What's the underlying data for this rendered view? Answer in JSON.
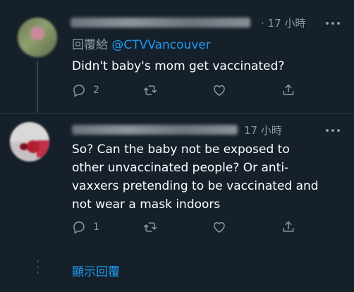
{
  "tweets": [
    {
      "time": "· 17 小時",
      "reply_prefix": "回覆給",
      "reply_handle": "@CTVVancouver",
      "text": "Didn't baby's mom get vaccinated?",
      "reply_count": "2",
      "retweet_count": "",
      "like_count": ""
    },
    {
      "time": "17 小時",
      "text": "So? Can the baby not be exposed to\nother unvaccinated people?  Or anti-\nvaxxers pretending to be vaccinated and\nnot wear a mask indoors",
      "reply_count": "1",
      "retweet_count": "",
      "like_count": ""
    }
  ],
  "show_replies_label": "顯示回覆",
  "colors": {
    "background": "#15202b",
    "text": "#ffffff",
    "secondary": "#8b98a5",
    "accent": "#1d9bf0"
  },
  "icons": [
    "reply-icon",
    "retweet-icon",
    "like-icon",
    "share-icon",
    "more-icon"
  ]
}
